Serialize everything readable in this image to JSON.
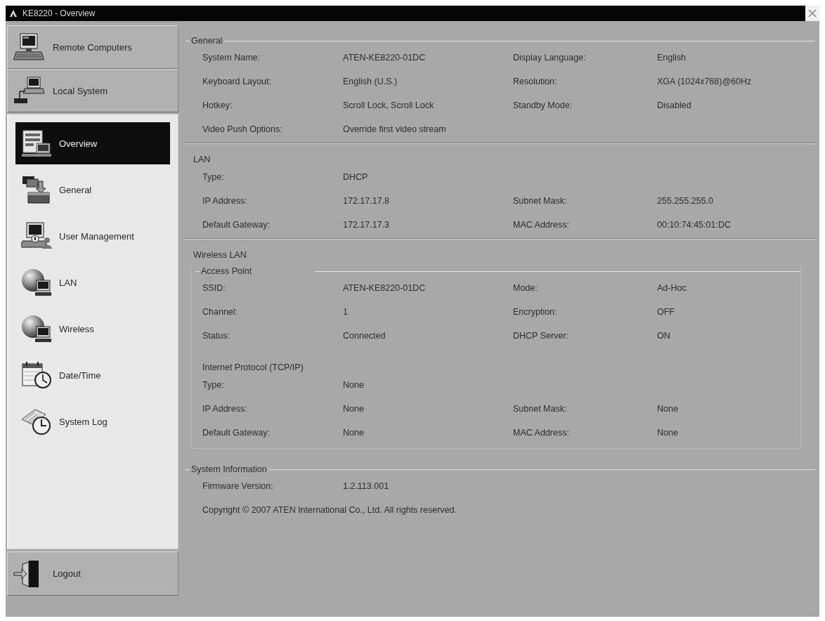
{
  "window": {
    "title": "KE8220 - Overview"
  },
  "sidebar": {
    "mode_buttons": [
      "Remote Computers",
      "Local System"
    ],
    "nav_items": [
      {
        "label": "Overview",
        "selected": true
      },
      {
        "label": "General",
        "selected": false
      },
      {
        "label": "User Management",
        "selected": false
      },
      {
        "label": "LAN",
        "selected": false
      },
      {
        "label": "Wireless",
        "selected": false
      },
      {
        "label": "Date/Time",
        "selected": false
      },
      {
        "label": "System Log",
        "selected": false
      }
    ],
    "logout_button": {
      "label": "Logout"
    }
  },
  "content": {
    "sections": [
      {
        "kind": "fieldset",
        "title": "General",
        "rows": [
          [
            {
              "label": "System Name:",
              "value": "ATEN-KE8220-01DC"
            },
            {
              "label": "Display Language:",
              "value": "English"
            }
          ],
          [
            {
              "label": "Keyboard Layout:",
              "value": "English (U.S.)"
            },
            {
              "label": "Resolution:",
              "value": "XGA (1024x768)@60Hz"
            }
          ],
          [
            {
              "label": "Hotkey:",
              "value": "Scroll Lock, Scroll Lock"
            },
            {
              "label": "Standby Mode:",
              "value": "Disabled"
            }
          ],
          [
            {
              "label": "Video Push Options:",
              "value": "Override first video stream"
            }
          ]
        ]
      },
      {
        "kind": "group",
        "title": "LAN",
        "rows": [
          [
            {
              "label": "Type:",
              "value": "DHCP"
            }
          ],
          [
            {
              "label": "IP Address:",
              "value": "172.17.17.8"
            },
            {
              "label": "Subnet Mask:",
              "value": "255.255.255.0"
            }
          ],
          [
            {
              "label": "Default Gateway:",
              "value": "172.17.17.3"
            },
            {
              "label": "MAC Address:",
              "value": "00:10:74:45:01:DC"
            }
          ]
        ]
      },
      {
        "kind": "group",
        "title": "Wireless LAN",
        "sections": [
          {
            "kind": "box",
            "title": "Access Point",
            "rows": [
              [
                {
                  "label": "SSID:",
                  "value": "ATEN-KE8220-01DC"
                },
                {
                  "label": "Mode:",
                  "value": "Ad-Hoc"
                }
              ],
              [
                {
                  "label": "Channel:",
                  "value": "1"
                },
                {
                  "label": "Encryption:",
                  "value": "OFF"
                }
              ],
              [
                {
                  "label": "Status:",
                  "value": "Connected"
                },
                {
                  "label": "DHCP Server:",
                  "value": "ON"
                }
              ]
            ],
            "sections": [
              {
                "kind": "plain",
                "title": "Internet Protocol (TCP/IP)",
                "rows": [
                  [
                    {
                      "label": "Type:",
                      "value": "None"
                    }
                  ],
                  [
                    {
                      "label": "IP Address:",
                      "value": "None"
                    },
                    {
                      "label": "Subnet Mask:",
                      "value": "None"
                    }
                  ],
                  [
                    {
                      "label": "Default Gateway:",
                      "value": "None"
                    },
                    {
                      "label": "MAC Address:",
                      "value": "None"
                    }
                  ]
                ]
              }
            ]
          }
        ]
      },
      {
        "kind": "fieldset",
        "title": "System Information",
        "rows": [
          [
            {
              "label": "Firmware Version:",
              "value": "1.2.113.001"
            }
          ]
        ],
        "note": "Copyright © 2007 ATEN International Co., Ltd. All rights reserved."
      }
    ]
  }
}
